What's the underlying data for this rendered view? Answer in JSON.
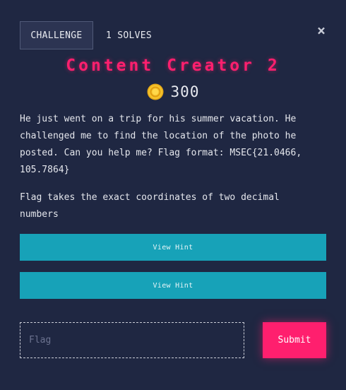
{
  "header": {
    "tab_challenge": "CHALLENGE",
    "tab_solves": "1 SOLVES",
    "close_glyph": "×",
    "close_icon": "close-icon"
  },
  "challenge": {
    "title": "Content Creator 2",
    "points": "300",
    "points_icon": "coin-icon",
    "description": "He just went on a trip for his summer vacation. He\nchallenged me to find the location of the photo he\nposted. Can you help me? Flag format: MSEC{21.0466,\n105.7864}",
    "note": "Flag takes the exact coordinates of two decimal\nnumbers"
  },
  "hints": [
    {
      "label": "View Hint"
    },
    {
      "label": "View Hint"
    }
  ],
  "form": {
    "flag_placeholder": "Flag",
    "flag_value": "",
    "submit_label": "Submit"
  },
  "colors": {
    "background": "#1f2742",
    "accent_pink": "#ff1f6e",
    "hint_teal": "#17a2b8",
    "coin_gold": "#f4c22b"
  }
}
